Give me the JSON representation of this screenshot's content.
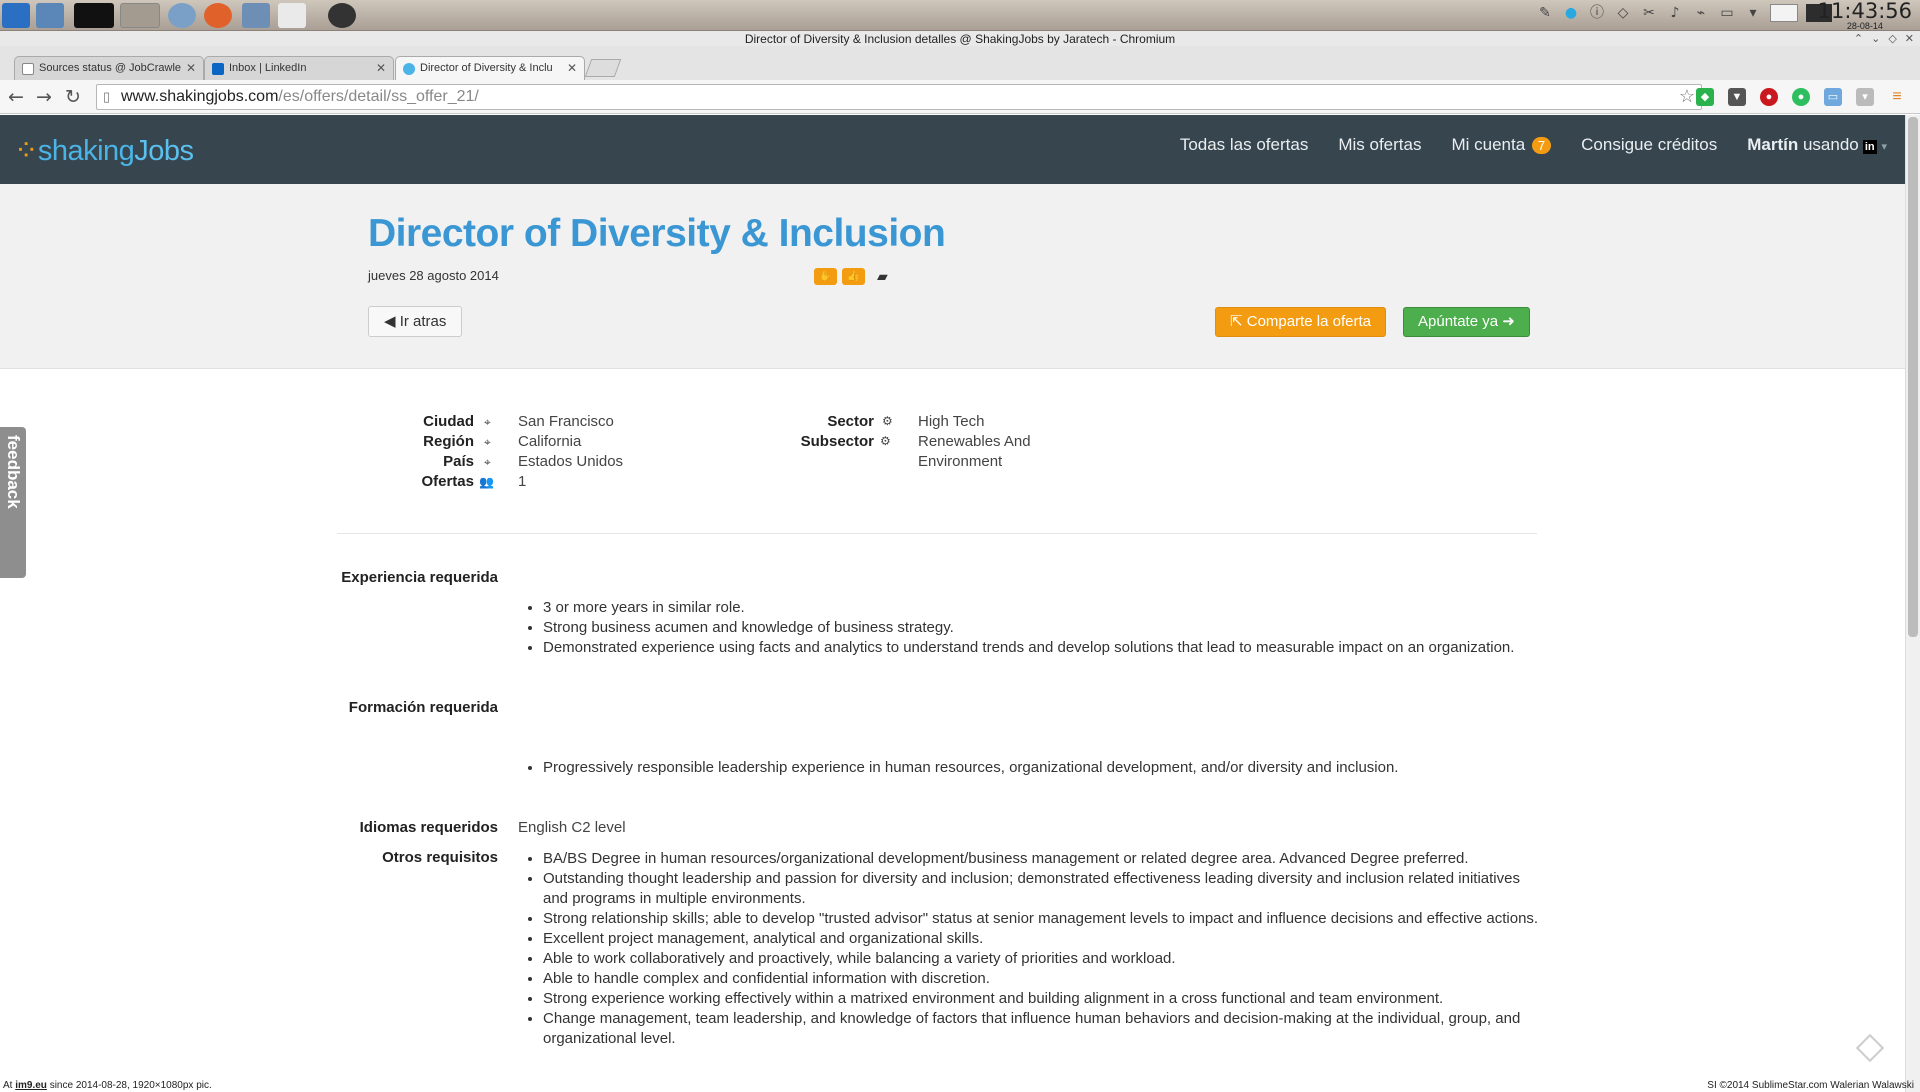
{
  "os": {
    "clock_time": "11:43:56",
    "clock_date": "28-08-14"
  },
  "browser": {
    "window_title": "Director of Diversity & Inclusion detalles @ ShakingJobs by Jaratech - Chromium",
    "tabs": [
      {
        "label": "Sources status @ JobCrawle"
      },
      {
        "label": "Inbox | LinkedIn"
      },
      {
        "label": "Director of Diversity & Inclu"
      }
    ],
    "url_host": "www.shakingjobs.com",
    "url_path": "/es/offers/detail/ss_offer_21/"
  },
  "site": {
    "logo_part1": "shaking",
    "logo_part2": "Jobs",
    "nav": {
      "all_offers": "Todas las ofertas",
      "my_offers": "Mis ofertas",
      "my_account": "Mi cuenta",
      "account_badge": "7",
      "credits": "Consigue créditos",
      "user_name": "Martín",
      "user_suffix": "usando",
      "linkedin_glyph": "in"
    }
  },
  "job": {
    "title": "Director of Diversity & Inclusion",
    "date": "jueves 28 agosto 2014",
    "back_label": "Ir atras",
    "share_label": "Comparte la oferta",
    "apply_label": "Apúntate ya",
    "fields": {
      "city_label": "Ciudad",
      "city": "San Francisco",
      "region_label": "Región",
      "region": "California",
      "country_label": "País",
      "country": "Estados Unidos",
      "offers_label": "Ofertas",
      "offers": "1",
      "sector_label": "Sector",
      "sector": "High Tech",
      "subsector_label": "Subsector",
      "subsector_line1": "Renewables And",
      "subsector_line2": "Environment"
    },
    "experience_label": "Experiencia requerida",
    "experience": [
      "3 or more years in similar role.",
      "Strong business acumen and knowledge of business strategy.",
      "Demonstrated experience using facts and analytics to understand trends and develop solutions that lead to measurable impact on an organization."
    ],
    "education_label": "Formación requerida",
    "education": [
      "Progressively responsible leadership experience in human resources, organizational development, and/or diversity and inclusion."
    ],
    "languages_label": "Idiomas requeridos",
    "languages": "English C2 level",
    "other_label": "Otros requisitos",
    "other": [
      "BA/BS Degree in human resources/organizational development/business management or related degree area. Advanced Degree preferred.",
      "Outstanding thought leadership and passion for diversity and inclusion; demonstrated effectiveness leading diversity and inclusion related initiatives and programs in multiple environments.",
      "Strong relationship skills; able to develop \"trusted advisor\" status at senior management levels to impact and influence decisions and effective actions.",
      "Excellent project management, analytical and organizational skills.",
      "Able to work collaboratively and proactively, while balancing a variety of priorities and workload.",
      "Able to handle complex and confidential information with discretion.",
      "Strong experience working effectively within a matrixed environment and building alignment in a cross functional and team environment.",
      "Change management, team leadership, and knowledge of factors that influence human behaviors and decision-making at the individual, group, and organizational level."
    ],
    "feedback_label": "feedback"
  },
  "footer": {
    "left_prefix": "At ",
    "left_site": "im9.eu",
    "left_suffix": " since 2014-08-28, 1920×1080px pic.",
    "right": "SI ©2014 SublimeStar.com Walerian Walawski"
  }
}
